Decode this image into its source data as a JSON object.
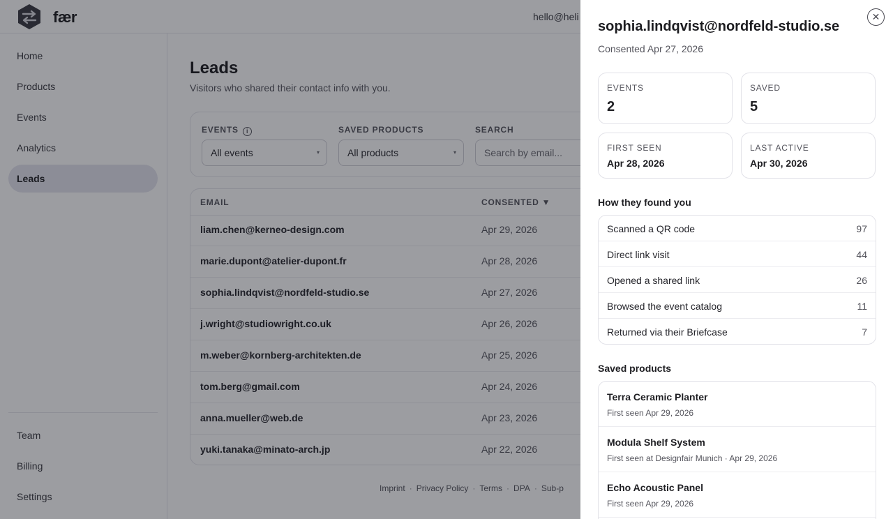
{
  "app": {
    "brand": "fær",
    "account_email": "hello@heli"
  },
  "sidebar": {
    "items": [
      {
        "label": "Home"
      },
      {
        "label": "Products"
      },
      {
        "label": "Events"
      },
      {
        "label": "Analytics"
      },
      {
        "label": "Leads",
        "active": true
      }
    ],
    "bottom_items": [
      {
        "label": "Team"
      },
      {
        "label": "Billing"
      },
      {
        "label": "Settings"
      }
    ]
  },
  "page": {
    "title": "Leads",
    "subtitle": "Visitors who shared their contact info with you."
  },
  "filters": {
    "events_label": "EVENTS",
    "events_value": "All events",
    "saved_products_label": "SAVED PRODUCTS",
    "saved_products_value": "All products",
    "search_label": "SEARCH",
    "search_placeholder": "Search by email..."
  },
  "table": {
    "headers": {
      "email": "EMAIL",
      "consented": "CONSENTED ▼"
    },
    "rows": [
      {
        "email": "liam.chen@kerneo-design.com",
        "consented": "Apr 29, 2026"
      },
      {
        "email": "marie.dupont@atelier-dupont.fr",
        "consented": "Apr 28, 2026"
      },
      {
        "email": "sophia.lindqvist@nordfeld-studio.se",
        "consented": "Apr 27, 2026"
      },
      {
        "email": "j.wright@studiowright.co.uk",
        "consented": "Apr 26, 2026"
      },
      {
        "email": "m.weber@kornberg-architekten.de",
        "consented": "Apr 25, 2026"
      },
      {
        "email": "tom.berg@gmail.com",
        "consented": "Apr 24, 2026"
      },
      {
        "email": "anna.mueller@web.de",
        "consented": "Apr 23, 2026"
      },
      {
        "email": "yuki.tanaka@minato-arch.jp",
        "consented": "Apr 22, 2026"
      }
    ]
  },
  "footer": {
    "links": [
      "Imprint",
      "Privacy Policy",
      "Terms",
      "DPA",
      "Sub-p"
    ]
  },
  "drawer": {
    "close_icon": "close-icon",
    "title": "sophia.lindqvist@nordfeld-studio.se",
    "subtitle": "Consented Apr 27, 2026",
    "stats": {
      "events": {
        "label": "EVENTS",
        "value": "2"
      },
      "saved": {
        "label": "SAVED",
        "value": "5"
      },
      "first_seen": {
        "label": "FIRST SEEN",
        "value": "Apr 28, 2026"
      },
      "last_active": {
        "label": "LAST ACTIVE",
        "value": "Apr 30, 2026"
      }
    },
    "sources_title": "How they found you",
    "sources": [
      {
        "label": "Scanned a QR code",
        "count": "97"
      },
      {
        "label": "Direct link visit",
        "count": "44"
      },
      {
        "label": "Opened a shared link",
        "count": "26"
      },
      {
        "label": "Browsed the event catalog",
        "count": "11"
      },
      {
        "label": "Returned via their Briefcase",
        "count": "7"
      }
    ],
    "saved_title": "Saved products",
    "saved_products": [
      {
        "name": "Terra Ceramic Planter",
        "meta": "First seen Apr 29, 2026"
      },
      {
        "name": "Modula Shelf System",
        "meta": "First seen at Designfair Munich · Apr 29, 2026"
      },
      {
        "name": "Echo Acoustic Panel",
        "meta": "First seen Apr 29, 2026"
      }
    ]
  }
}
